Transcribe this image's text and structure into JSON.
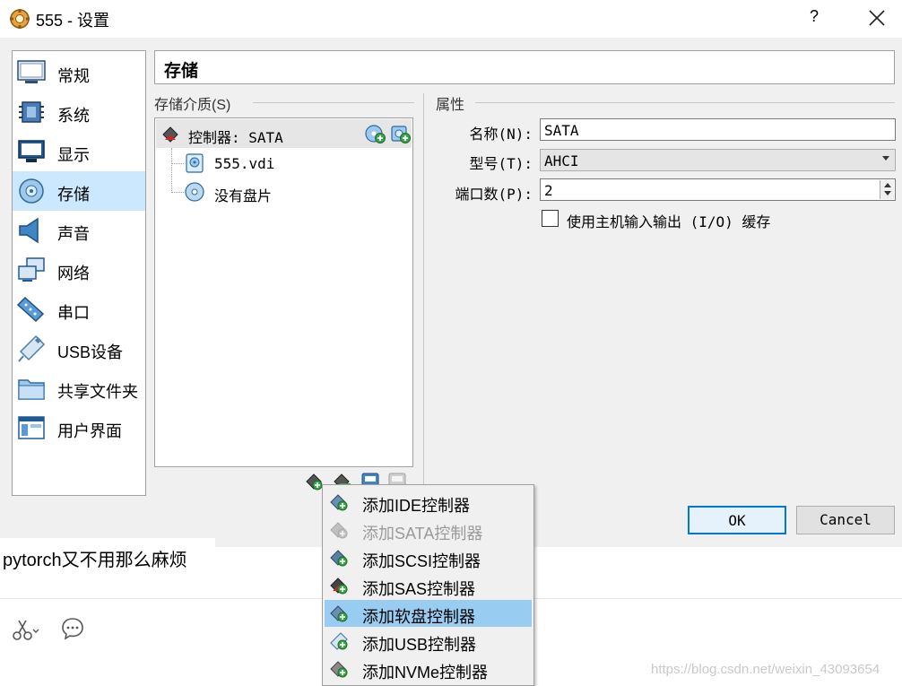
{
  "window": {
    "title": "555 - 设置",
    "help": "?"
  },
  "sidebar": {
    "items": [
      {
        "label": "常规",
        "icon": "general-icon"
      },
      {
        "label": "系统",
        "icon": "system-icon"
      },
      {
        "label": "显示",
        "icon": "display-icon"
      },
      {
        "label": "存储",
        "icon": "storage-icon",
        "active": true
      },
      {
        "label": "声音",
        "icon": "audio-icon"
      },
      {
        "label": "网络",
        "icon": "network-icon"
      },
      {
        "label": "串口",
        "icon": "serial-port-icon"
      },
      {
        "label": "USB设备",
        "icon": "usb-icon"
      },
      {
        "label": "共享文件夹",
        "icon": "shared-folder-icon"
      },
      {
        "label": "用户界面",
        "icon": "user-interface-icon"
      }
    ]
  },
  "header": {
    "title": "存储"
  },
  "storage": {
    "section_label": "存储介质(S)",
    "controller_label": "控制器: SATA",
    "disks": [
      {
        "label": "555.vdi",
        "icon": "hard-disk-icon"
      },
      {
        "label": "没有盘片",
        "icon": "optical-disc-icon"
      }
    ]
  },
  "attributes": {
    "section_label": "属性",
    "name_label": "名称(N):",
    "name_value": "SATA",
    "type_label": "型号(T):",
    "type_value": "AHCI",
    "port_label": "端口数(P):",
    "port_value": "2",
    "cache_label": "使用主机输入输出 (I/O) 缓存",
    "cache_checked": false
  },
  "buttons": {
    "ok": "OK",
    "cancel": "Cancel"
  },
  "menu": {
    "items": [
      {
        "label": "添加IDE控制器",
        "enabled": true
      },
      {
        "label": "添加SATA控制器",
        "enabled": false
      },
      {
        "label": "添加SCSI控制器",
        "enabled": true
      },
      {
        "label": "添加SAS控制器",
        "enabled": true
      },
      {
        "label": "添加软盘控制器",
        "enabled": true,
        "highlighted": true
      },
      {
        "label": "添加USB控制器",
        "enabled": true
      },
      {
        "label": "添加NVMe控制器",
        "enabled": true
      }
    ]
  },
  "chat": {
    "message": "pytorch又不用那么麻烦"
  },
  "watermark": "https://blog.csdn.net/weixin_43093654"
}
